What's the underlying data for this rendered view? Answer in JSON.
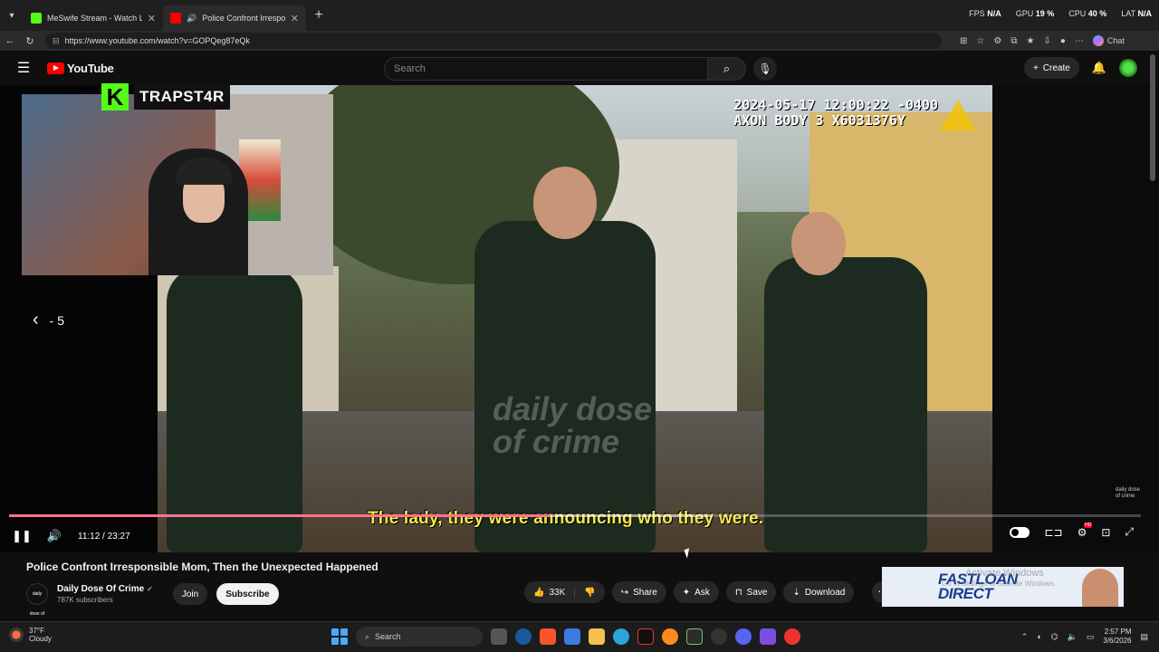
{
  "browser": {
    "tabs": [
      {
        "title": "MeSwife Stream - Watch Live",
        "active": false,
        "favicon_color": "#53fc18"
      },
      {
        "title": "Police Confront Irresponsible",
        "active": true,
        "favicon_color": "#ff0000"
      }
    ],
    "url": "https://www.youtube.com/watch?v=GOPQeg87eQk",
    "stats": {
      "fps_label": "FPS",
      "fps_value": "N/A",
      "gpu_label": "GPU",
      "gpu_value": "19 %",
      "cpu_label": "CPU",
      "cpu_value": "40 %",
      "lat_label": "LAT",
      "lat_value": "N/A"
    },
    "chat_label": "Chat"
  },
  "youtube": {
    "logo_text": "YouTube",
    "search_placeholder": "Search",
    "create_label": "Create"
  },
  "video": {
    "timestamp_line1": "2024-05-17 12:00:22 -0400",
    "timestamp_line2": "AXON BODY 3 X6031376Y",
    "watermark": "daily dose of crime",
    "streamer_badge": "K",
    "streamer_name": "TRAPST4R",
    "skip_label": "- 5",
    "caption": "The lady, they were announcing who they were.",
    "corner_logo": "daily dose of crime",
    "current_time": "11:12",
    "duration": "23:27",
    "time_display": "11:12 / 23:27",
    "progress_fraction": 0.478,
    "buffered_fraction": 0.62
  },
  "details": {
    "title": "Police Confront Irresponsible Mom, Then the Unexpected Happened",
    "channel_name": "Daily Dose Of Crime",
    "channel_avatar_text": "daily dose of crime",
    "subscribers": "787K subscribers",
    "join_label": "Join",
    "subscribe_label": "Subscribe",
    "likes": "33K",
    "share_label": "Share",
    "ask_label": "Ask",
    "save_label": "Save",
    "download_label": "Download"
  },
  "ad": {
    "brand": "FASTLOAN DIRECT",
    "watermark_line1": "Activate Windows",
    "watermark_line2": "Go to Settings to activate Windows."
  },
  "taskbar": {
    "temperature": "37°F",
    "condition": "Cloudy",
    "weather_badge": "3",
    "search_label": "Search",
    "time": "2:57 PM",
    "date": "3/6/2026"
  }
}
